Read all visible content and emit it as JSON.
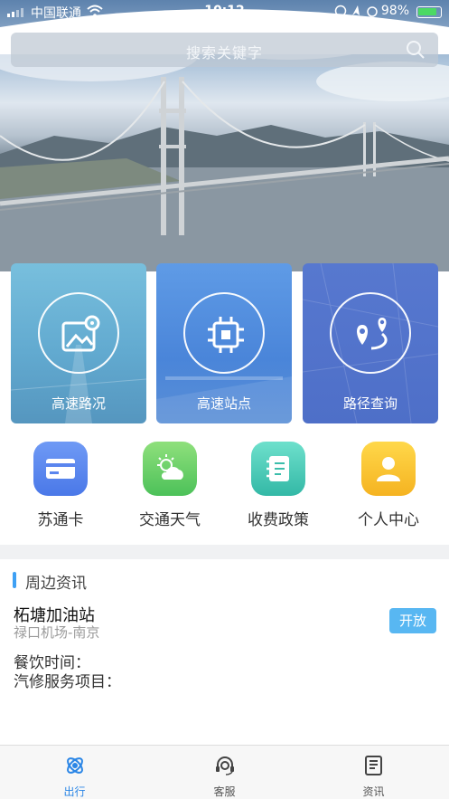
{
  "status_bar": {
    "carrier": "中国联通",
    "time": "10:12",
    "battery": "98%"
  },
  "search": {
    "placeholder": "搜索关键字",
    "icon": "search-icon"
  },
  "tiles": [
    {
      "label": "高速路况",
      "icon": "map-image-icon"
    },
    {
      "label": "高速站点",
      "icon": "chip-icon"
    },
    {
      "label": "路径查询",
      "icon": "route-icon"
    }
  ],
  "shortcuts": [
    {
      "label": "苏通卡",
      "icon": "card-icon"
    },
    {
      "label": "交通天气",
      "icon": "weather-icon"
    },
    {
      "label": "收费政策",
      "icon": "notebook-icon"
    },
    {
      "label": "个人中心",
      "icon": "person-icon"
    }
  ],
  "news": {
    "section_title": "周边资讯",
    "station_name": "柘塘加油站",
    "station_route": "禄口机场-南京",
    "status_badge": "开放",
    "dining_label": "餐饮时间：",
    "repair_label": "汽修服务项目："
  },
  "tabbar": {
    "items": [
      {
        "label": "出行",
        "icon": "travel-icon",
        "active": true
      },
      {
        "label": "客服",
        "icon": "customer-service-icon",
        "active": false
      },
      {
        "label": "资讯",
        "icon": "news-icon",
        "active": false
      }
    ]
  },
  "colors": {
    "accent": "#2b86e6",
    "badge": "#58b7f2",
    "section_bar": "#3ea0f4"
  }
}
